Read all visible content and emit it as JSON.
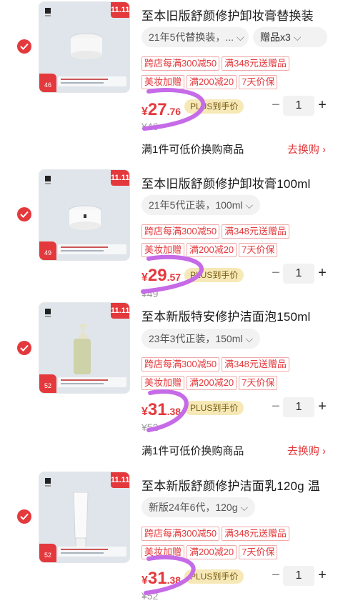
{
  "accent_color": "#e4393c",
  "items": [
    {
      "title": "至本旧版舒颜修护卸妆膏替换装",
      "variant": "21年5代替换装，...",
      "gift": "赠品x3",
      "tags": [
        "跨店每满300减50",
        "满348元送赠品",
        "美妆加赠",
        "满200减20",
        "7天价保"
      ],
      "price_yen": "¥",
      "price_int": "27",
      "price_dec": ".76",
      "plus_label": "PLUS到手价",
      "original_price": "¥46",
      "thumb_price": "46",
      "quantity": "1",
      "exchange_text": "满1件可低价换购商品",
      "swap_text": "去换购 ›"
    },
    {
      "title": "至本旧版舒颜修护卸妆膏100ml",
      "variant": "21年5代正装，100ml",
      "tags": [
        "跨店每满300减50",
        "满348元送赠品",
        "美妆加赠",
        "满200减20",
        "7天价保"
      ],
      "price_yen": "¥",
      "price_int": "29",
      "price_dec": ".57",
      "plus_label": "PLUS到手价",
      "original_price": "¥49",
      "thumb_price": "49",
      "quantity": "1"
    },
    {
      "title": "至本新版特安修护洁面泡150ml",
      "variant": "23年3代正装，150ml",
      "tags": [
        "跨店每满300减50",
        "满348元送赠品",
        "美妆加赠",
        "满200减20",
        "7天价保"
      ],
      "price_yen": "¥",
      "price_int": "31",
      "price_dec": ".38",
      "plus_label": "PLUS到手价",
      "original_price": "¥52",
      "thumb_price": "52",
      "quantity": "1",
      "exchange_text": "满1件可低价换购商品",
      "swap_text": "去换购 ›"
    },
    {
      "title": "至本新版舒颜修护洁面乳120g 温",
      "variant": "新版24年6代，120g",
      "tags": [
        "跨店每满300减50",
        "满348元送赠品",
        "美妆加赠",
        "满200减20",
        "7天价保"
      ],
      "price_yen": "¥",
      "price_int": "31",
      "price_dec": ".38",
      "plus_label": "PLUS到手价",
      "original_price": "¥52",
      "thumb_price": "52",
      "quantity": "1"
    }
  ],
  "ribbon_text": "11.11",
  "icons": {
    "check": "checkmark-icon",
    "dropdown": "chevron-down-icon",
    "minus": "minus-icon",
    "plus": "plus-icon"
  }
}
